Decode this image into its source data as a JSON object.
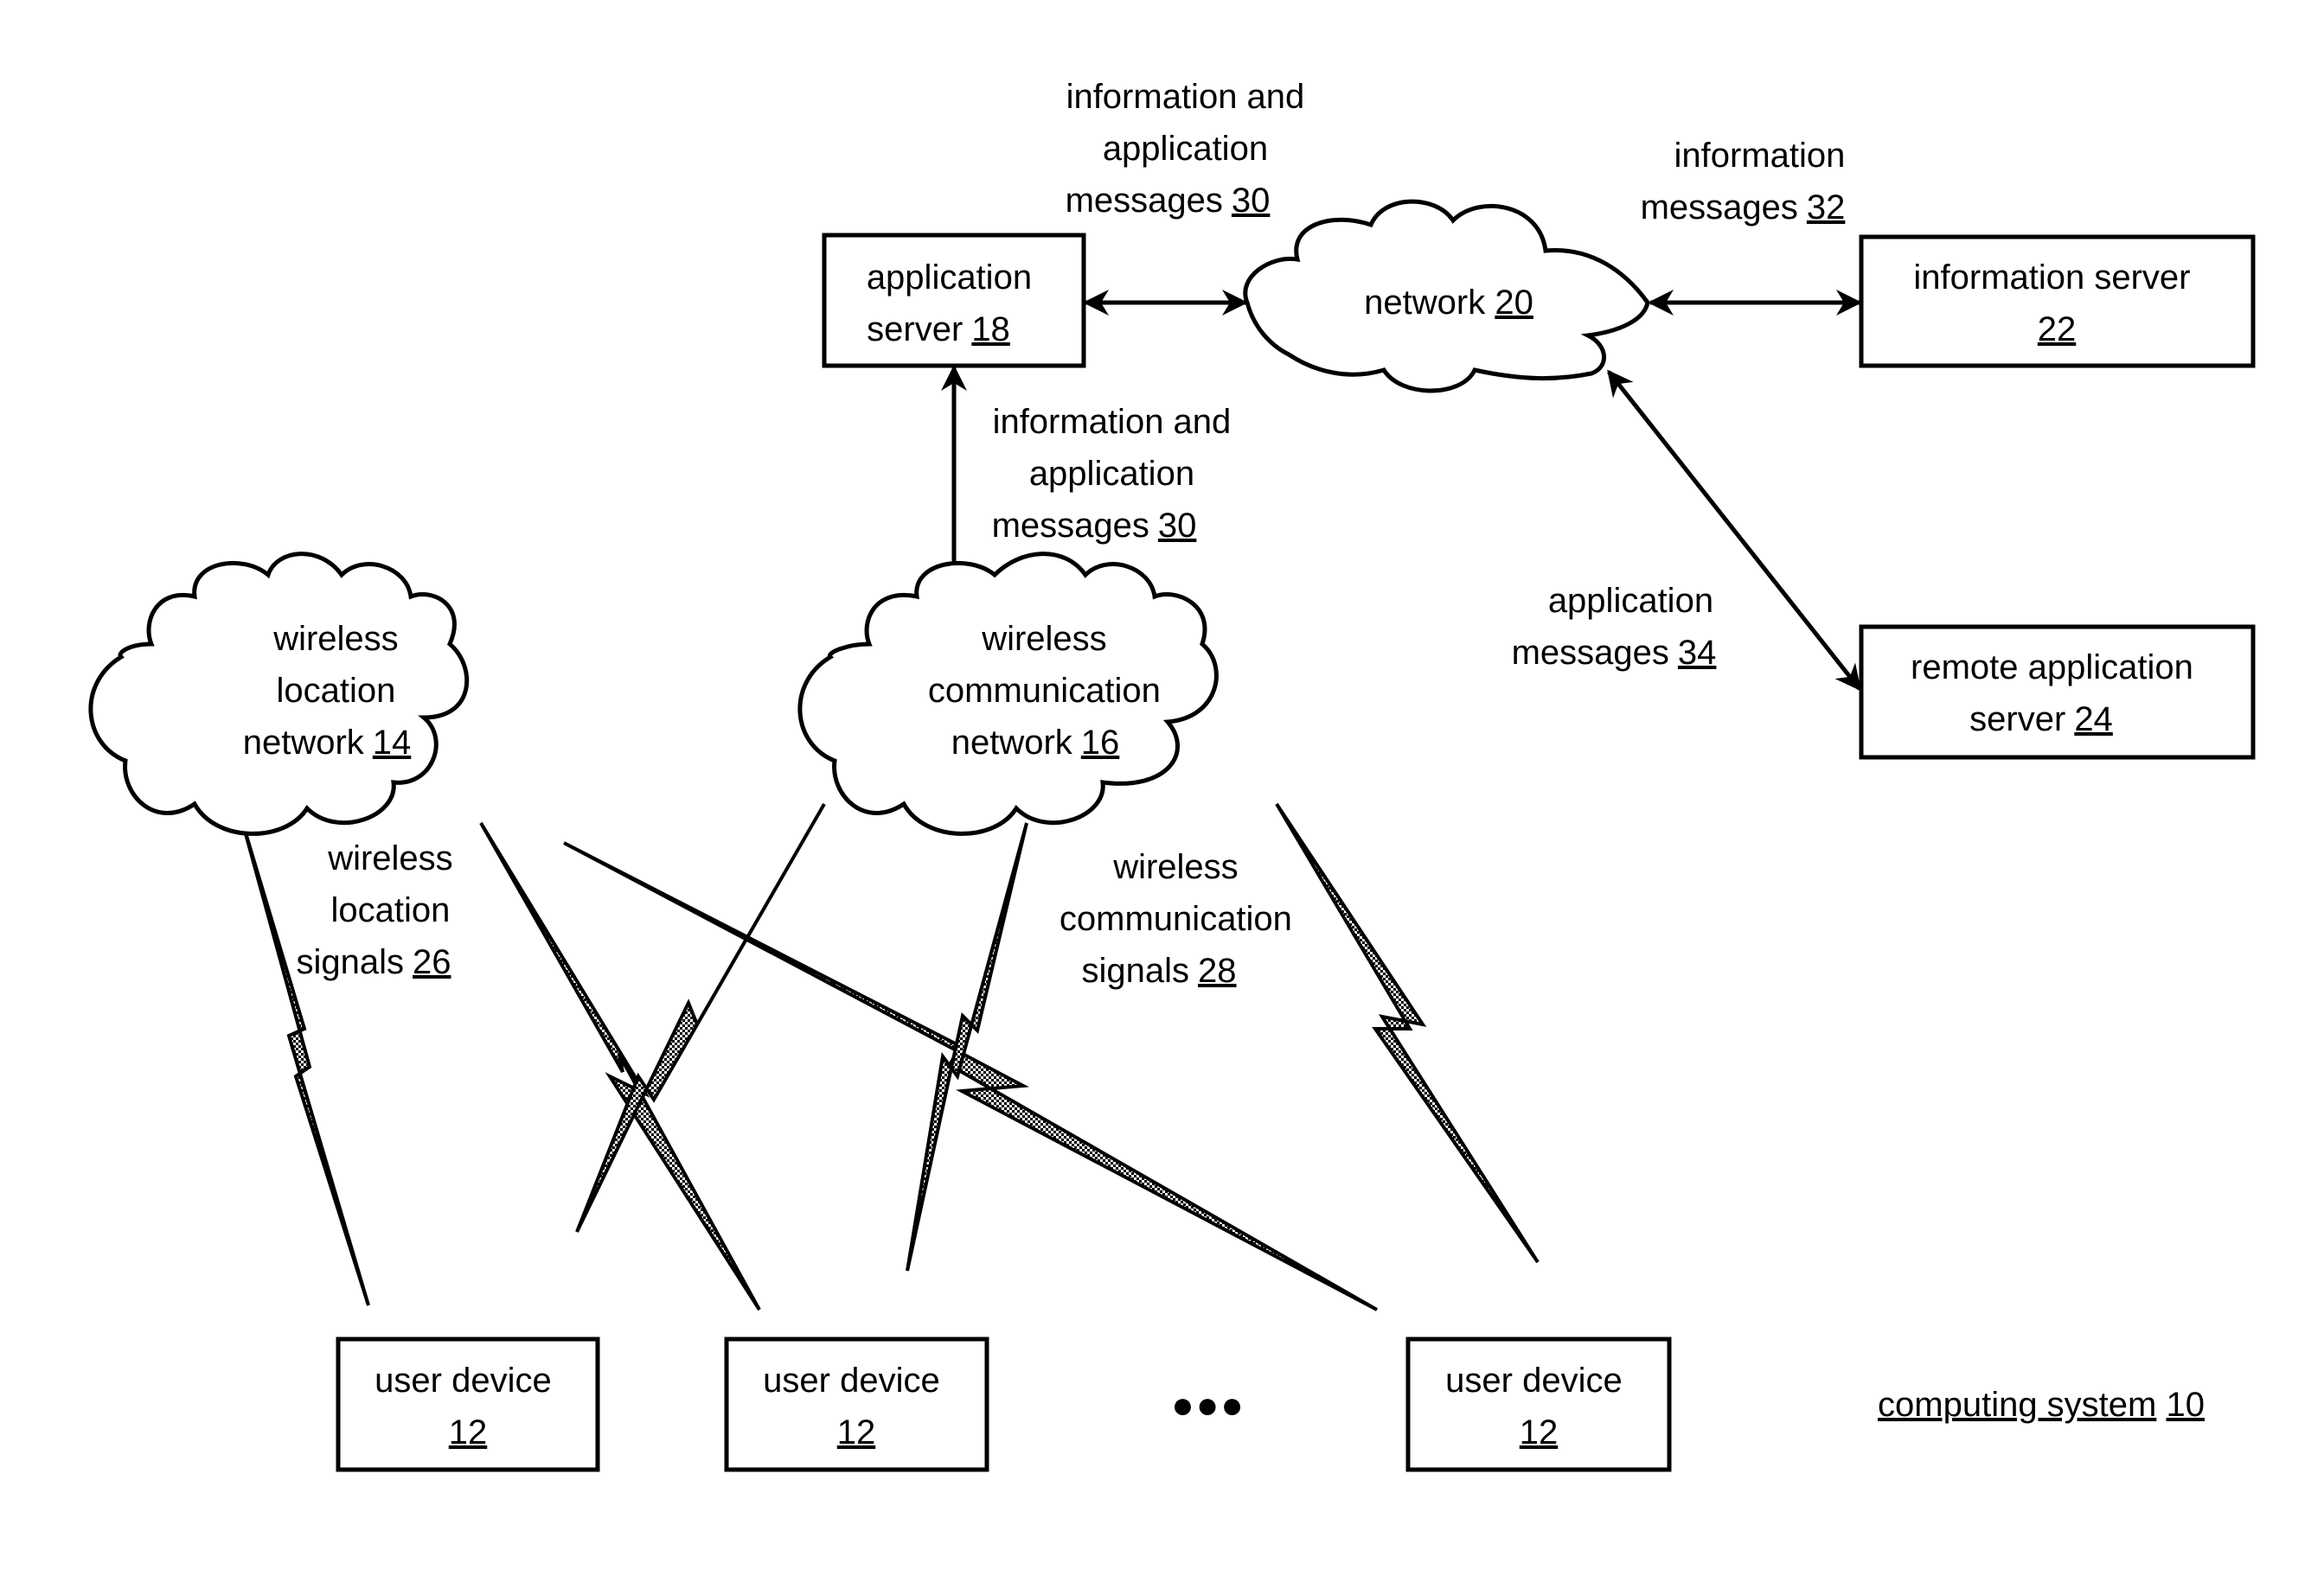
{
  "figure": {
    "title": "computing system",
    "title_ref": "10"
  },
  "nodes": {
    "application_server": {
      "lines": [
        "application",
        "server"
      ],
      "ref": "18",
      "shape": "box"
    },
    "network": {
      "lines": [
        "network"
      ],
      "ref": "20",
      "shape": "cloud"
    },
    "information_server": {
      "lines": [
        "information server"
      ],
      "ref": "22",
      "shape": "box"
    },
    "remote_application_server": {
      "lines": [
        "remote application",
        "server"
      ],
      "ref": "24",
      "shape": "box"
    },
    "wireless_location_network": {
      "lines": [
        "wireless",
        "location",
        "network"
      ],
      "ref": "14",
      "shape": "cloud"
    },
    "wireless_communication_network": {
      "lines": [
        "wireless",
        "communication",
        "network"
      ],
      "ref": "16",
      "shape": "cloud"
    },
    "user_devices": [
      {
        "lines": [
          "user device"
        ],
        "ref": "12"
      },
      {
        "lines": [
          "user device"
        ],
        "ref": "12"
      },
      {
        "lines": [
          "user device"
        ],
        "ref": "12"
      }
    ],
    "ellipsis": "●●●"
  },
  "edges": {
    "app_to_network": {
      "lines": [
        "information and",
        "application",
        "messages"
      ],
      "ref": "30",
      "from": "application_server",
      "to": "network",
      "bidirectional": true
    },
    "network_to_info": {
      "lines": [
        "information",
        "messages"
      ],
      "ref": "32",
      "from": "network",
      "to": "information_server",
      "bidirectional": true
    },
    "network_to_remote": {
      "lines": [
        "application",
        "messages"
      ],
      "ref": "34",
      "from": "network",
      "to": "remote_application_server",
      "bidirectional": true
    },
    "app_to_wireless_comm": {
      "lines": [
        "information and",
        "application",
        "messages"
      ],
      "ref": "30",
      "from": "application_server",
      "to": "wireless_communication_network",
      "bidirectional": true
    },
    "location_signals": {
      "lines": [
        "wireless",
        "location",
        "signals"
      ],
      "ref": "26"
    },
    "communication_signals": {
      "lines": [
        "wireless",
        "communication",
        "signals"
      ],
      "ref": "28"
    }
  }
}
